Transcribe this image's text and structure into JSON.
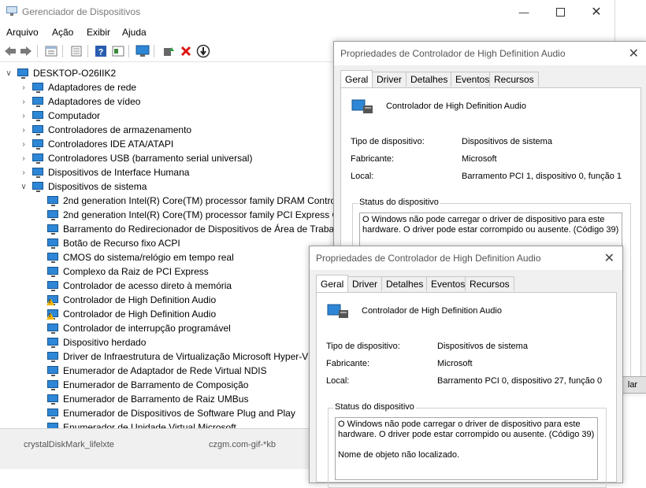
{
  "dm": {
    "title": "Gerenciador de Dispositivos",
    "menu": [
      "Arquivo",
      "Ação",
      "Exibir",
      "Ajuda"
    ],
    "tree": {
      "root": "DESKTOP-O26IIK2",
      "categories": [
        "Adaptadores de rede",
        "Adaptadores de vídeo",
        "Computador",
        "Controladores de armazenamento",
        "Controladores IDE ATA/ATAPI",
        "Controladores USB (barramento serial universal)",
        "Dispositivos de Interface Humana",
        "Dispositivos de sistema"
      ],
      "system_devices": [
        {
          "label": "2nd generation Intel(R) Core(TM) processor family DRAM Contro",
          "warning": false
        },
        {
          "label": "2nd generation Intel(R) Core(TM) processor family PCI Express Co",
          "warning": false
        },
        {
          "label": "Barramento do Redirecionador de Dispositivos de Área de Trabalh",
          "warning": false
        },
        {
          "label": "Botão de Recurso fixo ACPI",
          "warning": false
        },
        {
          "label": "CMOS do sistema/relógio em tempo real",
          "warning": false
        },
        {
          "label": "Complexo da Raiz de PCI Express",
          "warning": false
        },
        {
          "label": "Controlador de acesso direto à memória",
          "warning": false
        },
        {
          "label": "Controlador de High Definition Audio",
          "warning": true
        },
        {
          "label": "Controlador de High Definition Audio",
          "warning": true
        },
        {
          "label": "Controlador de interrupção programável",
          "warning": false
        },
        {
          "label": "Dispositivo herdado",
          "warning": false
        },
        {
          "label": "Driver de Infraestrutura de Virtualização Microsoft Hyper-V",
          "warning": false
        },
        {
          "label": "Enumerador de Adaptador de Rede Virtual NDIS",
          "warning": false
        },
        {
          "label": "Enumerador de Barramento de Composição",
          "warning": false
        },
        {
          "label": "Enumerador de Barramento de Raiz UMBus",
          "warning": false
        },
        {
          "label": "Enumerador de Dispositivos de Software Plug and Play",
          "warning": false
        },
        {
          "label": "Enumerador de Unidade Virtual Microsoft",
          "warning": false
        }
      ]
    },
    "statusbar_fragments": [
      "crystalDiskMark_lifelxte",
      "czgm.com-gif-*kb"
    ]
  },
  "dialog_back": {
    "title": "Propriedades de Controlador de High Definition Audio",
    "tabs": [
      "Geral",
      "Driver",
      "Detalhes",
      "Eventos",
      "Recursos"
    ],
    "device_name": "Controlador de High Definition Audio",
    "fields": [
      {
        "label": "Tipo de dispositivo:",
        "value": "Dispositivos de sistema"
      },
      {
        "label": "Fabricante:",
        "value": "Microsoft"
      },
      {
        "label": "Local:",
        "value": "Barramento PCI 1, dispositivo 0, função 1"
      }
    ],
    "status_group": "Status do dispositivo",
    "status_text": "O Windows não pode carregar o driver de dispositivo para este hardware. O driver pode estar corrompido ou ausente. (Código 39)",
    "button_fragment": "lar"
  },
  "dialog_front": {
    "title": "Propriedades de Controlador de High Definition Audio",
    "tabs": [
      "Geral",
      "Driver",
      "Detalhes",
      "Eventos",
      "Recursos"
    ],
    "device_name": "Controlador de High Definition Audio",
    "fields": [
      {
        "label": "Tipo de dispositivo:",
        "value": "Dispositivos de sistema"
      },
      {
        "label": "Fabricante:",
        "value": "Microsoft"
      },
      {
        "label": "Local:",
        "value": "Barramento PCI 0, dispositivo 27, função 0"
      }
    ],
    "status_group": "Status do dispositivo",
    "status_text": "O Windows não pode carregar o driver de dispositivo para este hardware. O driver pode estar corrompido ou ausente. (Código 39)",
    "status_text2": "Nome de objeto não localizado."
  },
  "icons": {
    "window_controls": [
      "minimize-icon",
      "maximize-icon",
      "close-icon"
    ],
    "toolbar": [
      "back-icon",
      "forward-icon",
      "properties-icon",
      "update-icon",
      "help-icon",
      "show-hidden-icon",
      "scan-hardware-icon",
      "enable-device-icon",
      "uninstall-icon",
      "disable-device-icon"
    ]
  }
}
